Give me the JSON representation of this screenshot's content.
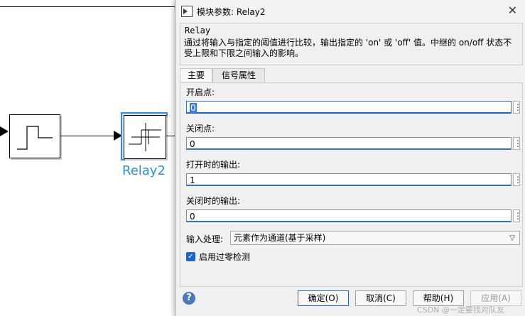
{
  "dialog": {
    "title": "模块参数: Relay2",
    "block_type": "Relay",
    "description": "通过将输入与指定的阈值进行比较，输出指定的 'on' 或 'off' 值。中继的 on/off 状态不受上限和下限之间输入的影响。",
    "tabs": [
      {
        "label": "主要",
        "active": true
      },
      {
        "label": "信号属性",
        "active": false
      }
    ],
    "fields": [
      {
        "label": "开启点:",
        "value": "0"
      },
      {
        "label": "关闭点:",
        "value": "0"
      },
      {
        "label": "打开时的输出:",
        "value": "1"
      },
      {
        "label": "关闭时的输出:",
        "value": "0"
      }
    ],
    "input_processing": {
      "label": "输入处理:",
      "value": "元素作为通道(基于采样)"
    },
    "zero_crossing": {
      "label": "启用过零检测",
      "checked": true
    },
    "buttons": {
      "ok": "确定(O)",
      "cancel": "取消(C)",
      "help": "帮助(H)",
      "apply": "应用(A)"
    }
  },
  "canvas": {
    "relay_label": "Relay2"
  },
  "watermark": "CSDN @一定要找对队友"
}
